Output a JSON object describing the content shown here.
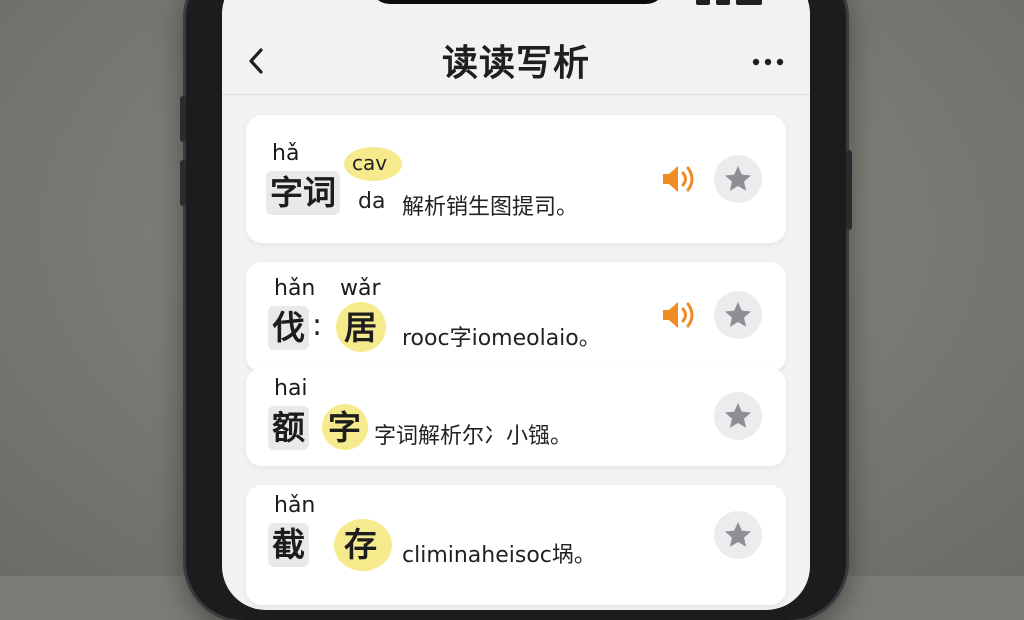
{
  "app": {
    "title": "读读写析"
  },
  "colors": {
    "accent_speaker": "#f08a24",
    "highlight": "#f5e878",
    "star": "#8e8e93"
  },
  "icons": {
    "back": "chevron-left-icon",
    "more": "more-horizontal-icon",
    "audio": "speaker-icon",
    "favorite": "star-icon"
  },
  "entries": [
    {
      "pinyin": "hǎ",
      "highlight_tag": "cav",
      "character": "字词",
      "tag_prefix": "da",
      "description": "解析销生图提司。",
      "has_audio": true
    },
    {
      "pinyin_left": "hǎn",
      "pinyin_right": "wǎr",
      "character_left": "伐",
      "character_right": "居",
      "description": "rooc字iomeolaio。",
      "has_audio": true
    },
    {
      "pinyin": "hai",
      "character_left": "额",
      "character_right": "字",
      "description": "字词解析尔冫小镪。",
      "has_audio": false
    },
    {
      "pinyin": "hǎn",
      "character_left": "截",
      "character_right": "存",
      "description": "climinaheisoc埚。",
      "has_audio": false
    }
  ]
}
